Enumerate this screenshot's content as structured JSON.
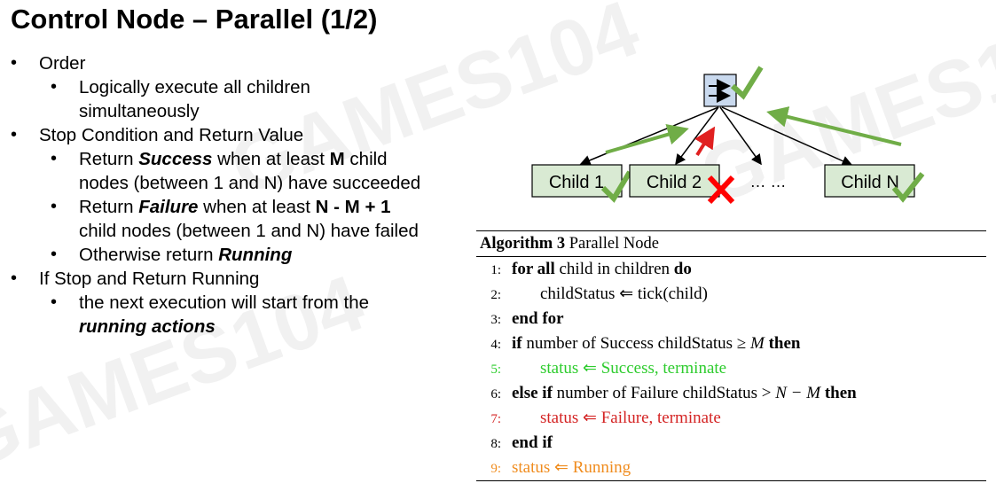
{
  "title": "Control Node – Parallel (1/2)",
  "bullets": {
    "order": "Order",
    "order_sub_1": "Logically execute all children",
    "order_sub_2": "simultaneously",
    "stop": "Stop Condition and Return Value",
    "success_1a": "Return ",
    "success_1b": "Success",
    "success_1c": " when at least ",
    "success_1d": "M",
    "success_1e": " child",
    "success_2": "nodes (between 1 and N) have succeeded",
    "failure_1a": "Return ",
    "failure_1b": "Failure",
    "failure_1c": " when at least ",
    "failure_1d": "N - M + 1",
    "failure_2": "child nodes (between 1 and N) have failed",
    "otherwise_a": "Otherwise return ",
    "otherwise_b": "Running",
    "if_stop": "If Stop and Return Running",
    "next_exec": "the next execution will start from the",
    "running_actions": "running actions"
  },
  "diagram": {
    "parent_icon": "parallel-arrows-icon",
    "children": [
      "Child 1",
      "Child 2",
      "Child N"
    ],
    "ellipsis": "… …",
    "colors": {
      "node_fill": "#d9ead3",
      "parent_fill": "#c9d9ee",
      "check": "#70ad47",
      "cross": "#ff0000"
    }
  },
  "algorithm": {
    "caption_bold": "Algorithm 3",
    "caption": " Parallel Node",
    "lines": [
      {
        "num": "1:",
        "indent": false,
        "color": "black"
      },
      {
        "num": "2:",
        "indent": true,
        "color": "black"
      },
      {
        "num": "3:",
        "indent": false,
        "color": "black"
      },
      {
        "num": "4:",
        "indent": false,
        "color": "black"
      },
      {
        "num": "5:",
        "indent": true,
        "color": "green"
      },
      {
        "num": "6:",
        "indent": false,
        "color": "black"
      },
      {
        "num": "7:",
        "indent": true,
        "color": "red"
      },
      {
        "num": "8:",
        "indent": false,
        "color": "black"
      },
      {
        "num": "9:",
        "indent": false,
        "color": "orange"
      }
    ],
    "l1": {
      "kw1": "for all",
      "t1": " child in children ",
      "kw2": "do"
    },
    "l2": {
      "t1": "childStatus ⇐ tick(child)"
    },
    "l3": {
      "kw1": "end for"
    },
    "l4": {
      "kw1": "if",
      "t1": " number of Success childStatus ≥ ",
      "m": "M",
      "kw2": " then"
    },
    "l5": {
      "t1": "status ⇐ Success, terminate"
    },
    "l6": {
      "kw1": "else if",
      "t1": " number of Failure childStatus > ",
      "m": "N − M",
      "kw2": " then"
    },
    "l7": {
      "t1": "status ⇐ Failure, terminate"
    },
    "l8": {
      "kw1": "end if"
    },
    "l9": {
      "t1": "status ⇐ Running"
    }
  },
  "watermark_text": "GAMES104"
}
